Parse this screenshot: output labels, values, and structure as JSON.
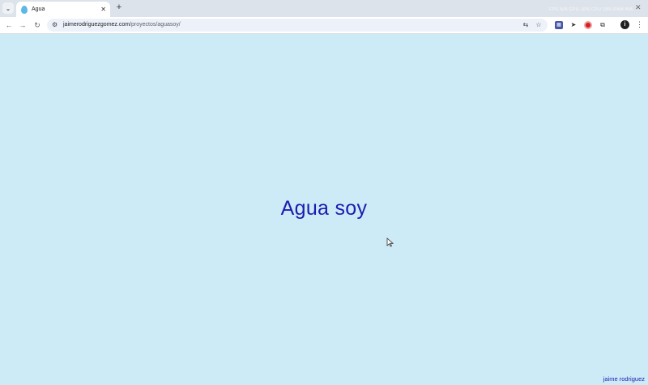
{
  "browser": {
    "tab": {
      "title": "Agua"
    },
    "system_overlay": "FPS N/A GPU 16% CPU 19% RAM N/A",
    "url": {
      "domain": "jaimerodriguezgomez.com",
      "path": "/proyectos/aguasoy/"
    }
  },
  "page": {
    "title": "Agua soy",
    "footer": "jaime rodriguez"
  },
  "colors": {
    "background": "#cdebf7",
    "text": "#1c1cb0"
  },
  "icons": {
    "back": "←",
    "forward": "→",
    "reload": "↻",
    "close": "✕",
    "new_tab": "+",
    "tab_search": "⌄",
    "site_info": "⚙",
    "translate": "⇆",
    "bookmark": "☆",
    "extensions": "⧉",
    "menu": "⋮",
    "profile": "i",
    "send": "➤",
    "ext_square": "▦"
  }
}
